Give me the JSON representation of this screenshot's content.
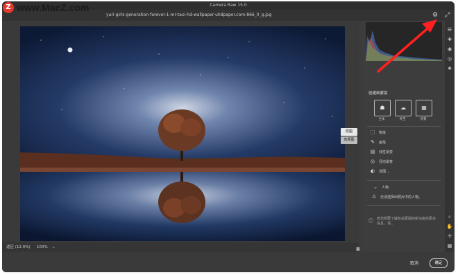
{
  "watermark": {
    "logo_glyph": "Z",
    "text": "www.MacZ.com"
  },
  "app": {
    "title": "Camera Raw 15.0"
  },
  "file": {
    "name": "yuri-girls-generation-forever-1-mr-taxi-hd-wallpaper-uhdpaper.com-866_0_g.jpg"
  },
  "header_icons": {
    "settings": "gear-icon",
    "fullscreen": "expand-icon"
  },
  "canvas_tabs": {
    "overlay": "原图",
    "effect": "效果图"
  },
  "status": {
    "zoom_fit": "适应 (12.0%)",
    "zoom_100": "100%",
    "zoom_menu": "⌄"
  },
  "mask_panel": {
    "title": "创建新蒙版",
    "buttons": [
      {
        "label": "主体",
        "icon": "person-icon"
      },
      {
        "label": "天空",
        "icon": "sky-icon"
      },
      {
        "label": "背景",
        "icon": "background-icon"
      }
    ],
    "options": [
      {
        "label": "物体",
        "icon": "object-select-icon"
      },
      {
        "label": "画笔",
        "icon": "brush-icon"
      },
      {
        "label": "线性渐变",
        "icon": "linear-gradient-icon"
      },
      {
        "label": "径向渐变",
        "icon": "radial-gradient-icon"
      },
      {
        "label": "范围 ⌄",
        "icon": "range-icon"
      }
    ],
    "people_section": {
      "title": "人物",
      "warning": "无法选择出照片中的人物。"
    },
    "help_text": "若您想要了解有关蒙版的新功能的更多信息，请..."
  },
  "tools": [
    "sliders-icon",
    "healing-icon",
    "masking-icon",
    "red-eye-icon",
    "presets-icon",
    "zoom-icon",
    "hand-icon",
    "sampler-icon",
    "grid-icon"
  ],
  "actions": {
    "cancel": "取消",
    "ok": "确定"
  },
  "colors": {
    "arrow": "#ff2020",
    "window": "#3c3c3c",
    "panel": "#3d3d3d"
  }
}
